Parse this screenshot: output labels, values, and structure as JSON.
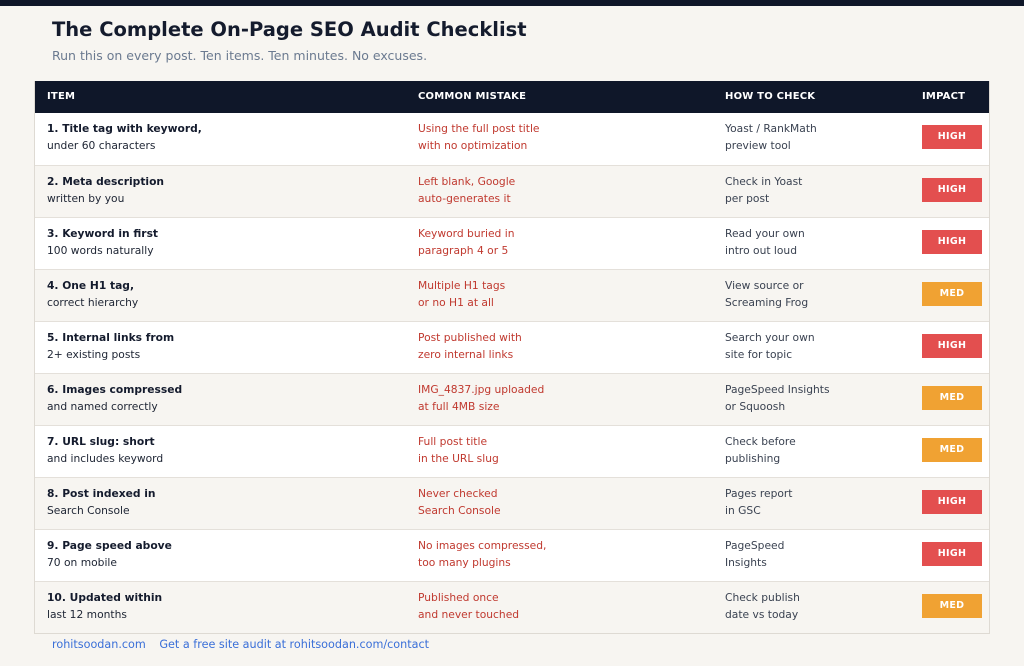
{
  "page": {
    "title": "The Complete On-Page SEO Audit Checklist",
    "subtitle": "Run this on every post. Ten items. Ten minutes. No excuses."
  },
  "table": {
    "headers": {
      "item": "ITEM",
      "mistake": "COMMON MISTAKE",
      "check": "HOW TO CHECK",
      "impact": "IMPACT"
    },
    "rows": [
      {
        "item": [
          "1. Title tag with keyword,",
          "under 60 characters"
        ],
        "mistake": [
          "Using the full post title",
          "with no optimization"
        ],
        "check": [
          "Yoast / RankMath",
          "preview tool"
        ],
        "impact": "HIGH"
      },
      {
        "item": [
          "2. Meta description",
          "written by you"
        ],
        "mistake": [
          "Left blank, Google",
          "auto-generates it"
        ],
        "check": [
          "Check in Yoast",
          "per post"
        ],
        "impact": "HIGH"
      },
      {
        "item": [
          "3. Keyword in first",
          "100 words naturally"
        ],
        "mistake": [
          "Keyword buried in",
          "paragraph 4 or 5"
        ],
        "check": [
          "Read your own",
          "intro out loud"
        ],
        "impact": "HIGH"
      },
      {
        "item": [
          "4. One H1 tag,",
          "correct hierarchy"
        ],
        "mistake": [
          "Multiple H1 tags",
          "or no H1 at all"
        ],
        "check": [
          "View source or",
          "Screaming Frog"
        ],
        "impact": "MED"
      },
      {
        "item": [
          "5. Internal links from",
          "2+ existing posts"
        ],
        "mistake": [
          "Post published with",
          "zero internal links"
        ],
        "check": [
          "Search your own",
          "site for topic"
        ],
        "impact": "HIGH"
      },
      {
        "item": [
          "6. Images compressed",
          "and named correctly"
        ],
        "mistake": [
          "IMG_4837.jpg uploaded",
          "at full 4MB size"
        ],
        "check": [
          "PageSpeed Insights",
          "or Squoosh"
        ],
        "impact": "MED"
      },
      {
        "item": [
          "7. URL slug: short",
          "and includes keyword"
        ],
        "mistake": [
          "Full post title",
          "in the URL slug"
        ],
        "check": [
          "Check before",
          "publishing"
        ],
        "impact": "MED"
      },
      {
        "item": [
          "8. Post indexed in",
          "Search Console"
        ],
        "mistake": [
          "Never checked",
          "Search Console"
        ],
        "check": [
          "Pages report",
          "in GSC"
        ],
        "impact": "HIGH"
      },
      {
        "item": [
          "9. Page speed above",
          "70 on mobile"
        ],
        "mistake": [
          "No images compressed,",
          "too many plugins"
        ],
        "check": [
          "PageSpeed",
          "Insights"
        ],
        "impact": "HIGH"
      },
      {
        "item": [
          "10. Updated within",
          "last 12 months"
        ],
        "mistake": [
          "Published once",
          "and never touched"
        ],
        "check": [
          "Check publish",
          "date vs today"
        ],
        "impact": "MED"
      }
    ]
  },
  "footer": {
    "site": "rohitsoodan.com",
    "cta": "Get a free site audit at rohitsoodan.com/contact"
  },
  "colors": {
    "header_bg": "#0f1729",
    "mistake_text": "#c0392f",
    "high_badge": "#e34f4f",
    "med_badge": "#f0a233",
    "link": "#3a6fd8"
  }
}
